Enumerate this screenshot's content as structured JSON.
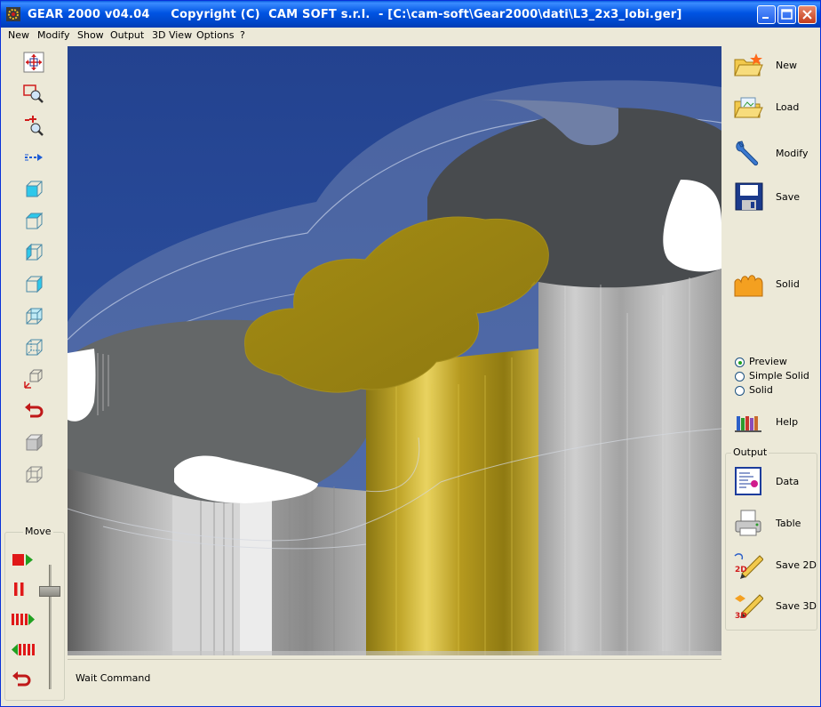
{
  "window": {
    "title": "GEAR 2000 v04.04     Copyright (C)  CAM SOFT s.r.l.  - [C:\\cam-soft\\Gear2000\\dati\\L3_2x3_lobi.ger]"
  },
  "menu": {
    "items": [
      "New",
      "Modify",
      "Show",
      "Output",
      "3D View",
      "Options",
      "?"
    ]
  },
  "left_toolbar": {
    "tools": [
      {
        "icon": "pan-move-icon"
      },
      {
        "icon": "zoom-window-icon"
      },
      {
        "icon": "zoom-in-out-icon"
      },
      {
        "icon": "dashed-arrow-icon"
      },
      {
        "icon": "view-cube-front-icon"
      },
      {
        "icon": "view-cube-top-icon"
      },
      {
        "icon": "view-cube-left-icon"
      },
      {
        "icon": "view-cube-right-icon"
      },
      {
        "icon": "view-cube-back-icon"
      },
      {
        "icon": "view-cube-iso-icon"
      },
      {
        "icon": "view-axes-cube-icon"
      },
      {
        "icon": "undo-view-icon"
      },
      {
        "icon": "solid-cube-icon"
      },
      {
        "icon": "wire-cube-icon"
      }
    ]
  },
  "move_panel": {
    "label": "Move",
    "buttons": [
      {
        "icon": "play-icon"
      },
      {
        "icon": "pause-icon"
      },
      {
        "icon": "step-forward-icon"
      },
      {
        "icon": "step-back-icon"
      },
      {
        "icon": "reset-icon"
      }
    ],
    "speed_level": 0.18
  },
  "right_panel": {
    "new_label": "New",
    "load_label": "Load",
    "modify_label": "Modify",
    "save_label": "Save",
    "solid_label": "Solid",
    "render_modes": [
      {
        "label": "Preview",
        "selected": true
      },
      {
        "label": "Simple Solid",
        "selected": false
      },
      {
        "label": "Solid",
        "selected": false
      }
    ],
    "help_label": "Help"
  },
  "output_panel": {
    "label": "Output",
    "data_label": "Data",
    "table_label": "Table",
    "save2d_label": "Save 2D",
    "save3d_label": "Save 3D"
  },
  "status": {
    "text": "Wait Command"
  },
  "colors": {
    "background_blue": "#2a4c96",
    "gear_gold": "#b09a1a",
    "body_gray": "#9c9c9c"
  }
}
